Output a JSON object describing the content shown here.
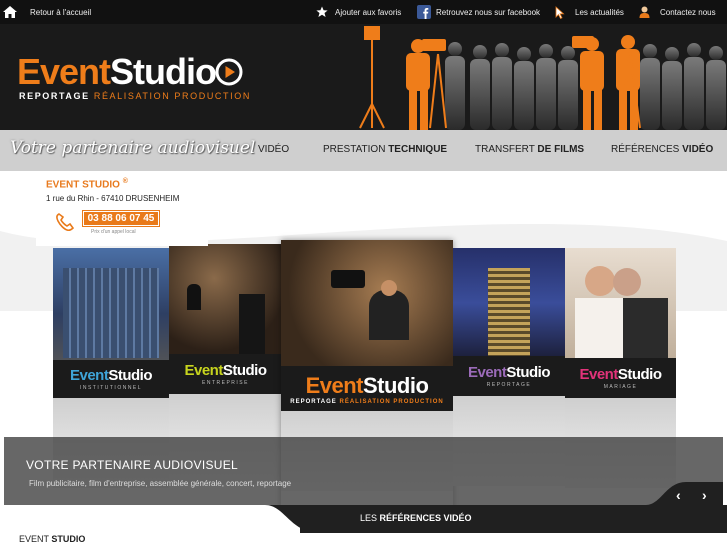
{
  "topbar": {
    "home": "Retour à l'accueil",
    "favorites": "Ajouter aux favoris",
    "facebook": "Retrouvez nous sur facebook",
    "news": "Les actualités",
    "contact": "Contactez nous"
  },
  "header": {
    "logo_part1": "Event",
    "logo_part2": "Studio",
    "tagline_1": "REPORTAGE",
    "tagline_2": "RÉALISATION",
    "tagline_3": "PRODUCTION"
  },
  "nav": {
    "slogan": "Votre partenaire audiovisuel",
    "video": "VIDÉO",
    "prestation_a": "PRESTATION",
    "prestation_b": "TECHNIQUE",
    "transfert_a": "TRANSFERT",
    "transfert_b": "DE FILMS",
    "references_a": "RÉFÉRENCES",
    "references_b": "VIDÉO"
  },
  "address": {
    "company": "EVENT STUDIO",
    "registered": "®",
    "street": "1 rue du Rhin - 67410 DRUSENHEIM",
    "phone": "03 88 06 07 45",
    "phone_note": "Prix d'un appel local"
  },
  "gallery": {
    "brand_event": "Event",
    "brand_studio": "Studio",
    "panels": [
      {
        "sub": "INSTITUTIONNEL"
      },
      {
        "sub": "ENTREPRISE"
      },
      {
        "sub": "REPORTAGE"
      },
      {
        "sub": "MARIAGE"
      }
    ],
    "center_tagline_1": "REPORTAGE",
    "center_tagline_2": "RÉALISATION",
    "center_tagline_3": "PRODUCTION"
  },
  "caption": {
    "title": "VOTRE PARTENAIRE AUDIOVISUEL",
    "description": "Film publicitaire, film d'entreprise, assemblée générale, concert, reportage"
  },
  "refbar": {
    "label_a": "LES",
    "label_b": "RÉFÉRENCES VIDÉO"
  },
  "footer": {
    "label_a": "EVENT",
    "label_b": "STUDIO"
  },
  "colors": {
    "accent": "#ef7d1a",
    "dark": "#1a1a1a",
    "nav_bg": "#cfcfcf"
  }
}
